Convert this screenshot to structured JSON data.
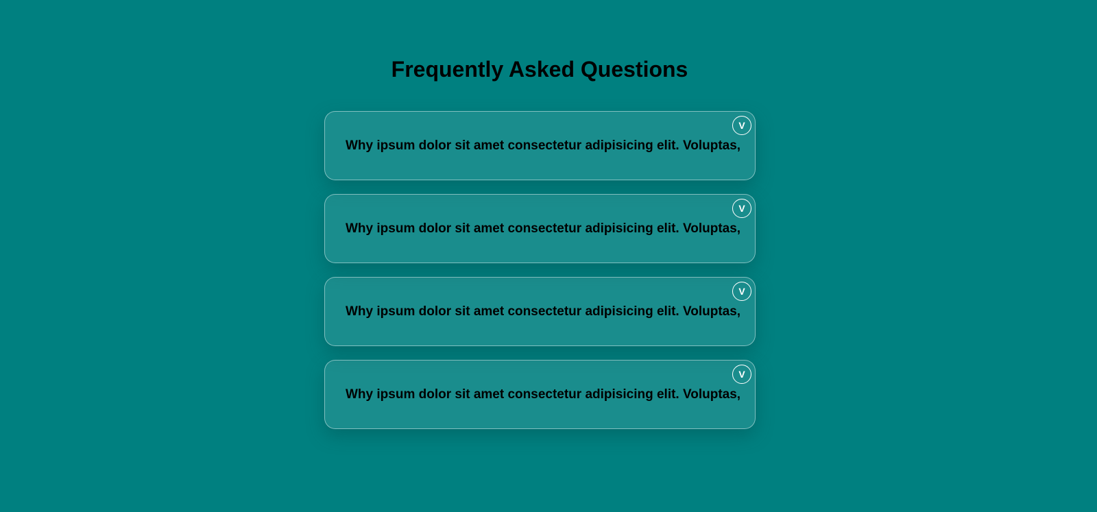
{
  "page": {
    "title": "Frequently Asked Questions"
  },
  "faq": {
    "items": [
      {
        "question": "Why ipsum dolor sit amet consectetur adipisicing elit. Voluptas,",
        "toggle_label": "V"
      },
      {
        "question": "Why ipsum dolor sit amet consectetur adipisicing elit. Voluptas,",
        "toggle_label": "V"
      },
      {
        "question": "Why ipsum dolor sit amet consectetur adipisicing elit. Voluptas,",
        "toggle_label": "V"
      },
      {
        "question": "Why ipsum dolor sit amet consectetur adipisicing elit. Voluptas,",
        "toggle_label": "V"
      }
    ]
  },
  "colors": {
    "background": "#008080",
    "card": "#188888",
    "text": "#000000",
    "toggle": "#ffffff"
  },
  "icons": {
    "toggle": "chevron-down-icon"
  }
}
